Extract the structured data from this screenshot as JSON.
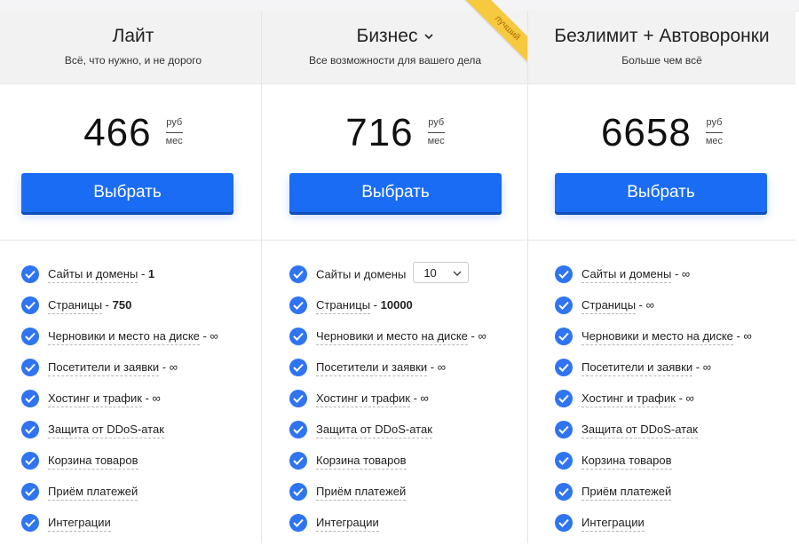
{
  "plans": [
    {
      "title": "Лайт",
      "subtitle": "Всё, что нужно, и не дорого",
      "price": "466",
      "currency": "руб",
      "period": "мес",
      "button": "Выбрать",
      "features": [
        {
          "label": "Сайты и домены",
          "sep": "-",
          "value": "1"
        },
        {
          "label": "Страницы",
          "sep": "-",
          "value": "750"
        },
        {
          "label": "Черновики и место на диске",
          "sep": "-",
          "value": "∞"
        },
        {
          "label": "Посетители и заявки",
          "sep": "-",
          "value": "∞"
        },
        {
          "label": "Хостинг и трафик",
          "sep": "-",
          "value": "∞"
        },
        {
          "label": "Защита от DDoS-атак"
        },
        {
          "label": "Корзина товаров"
        },
        {
          "label": "Приём платежей"
        },
        {
          "label": "Интеграции"
        }
      ]
    },
    {
      "title": "Бизнес",
      "subtitle": "Все возможности для вашего дела",
      "badge": "лучший",
      "price": "716",
      "currency": "руб",
      "period": "мес",
      "button": "Выбрать",
      "sites_select": "10",
      "features": [
        {
          "label": "Сайты и домены"
        },
        {
          "label": "Страницы",
          "sep": "-",
          "value": "10000"
        },
        {
          "label": "Черновики и место на диске",
          "sep": "-",
          "value": "∞"
        },
        {
          "label": "Посетители и заявки",
          "sep": "-",
          "value": "∞"
        },
        {
          "label": "Хостинг и трафик",
          "sep": "-",
          "value": "∞"
        },
        {
          "label": "Защита от DDoS-атак"
        },
        {
          "label": "Корзина товаров"
        },
        {
          "label": "Приём платежей"
        },
        {
          "label": "Интеграции"
        }
      ]
    },
    {
      "title": "Безлимит + Автоворонки",
      "subtitle": "Больше чем всё",
      "price": "6658",
      "currency": "руб",
      "period": "мес",
      "button": "Выбрать",
      "features": [
        {
          "label": "Сайты и домены",
          "sep": "-",
          "value": "∞"
        },
        {
          "label": "Страницы",
          "sep": "-",
          "value": "∞"
        },
        {
          "label": "Черновики и место на диске",
          "sep": "-",
          "value": "∞"
        },
        {
          "label": "Посетители и заявки",
          "sep": "-",
          "value": "∞"
        },
        {
          "label": "Хостинг и трафик",
          "sep": "-",
          "value": "∞"
        },
        {
          "label": "Защита от DDoS-атак"
        },
        {
          "label": "Корзина товаров"
        },
        {
          "label": "Приём платежей"
        },
        {
          "label": "Интеграции"
        }
      ]
    }
  ],
  "colors": {
    "accent": "#1a6cf5",
    "check": "#2f74f0",
    "header_bg": "#f2f2f3",
    "badge": "#f7c93f"
  },
  "icons": {
    "check": "check-icon",
    "dropdown": "chevron-down-icon"
  }
}
